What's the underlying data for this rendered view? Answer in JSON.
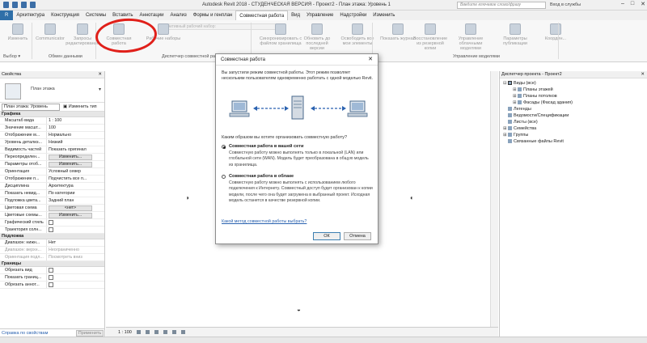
{
  "titlebar": {
    "title": "Autodesk Revit 2018 - СТУДЕНЧЕСКАЯ ВЕРСИЯ -   Проект2 - План этажа: Уровень 1",
    "search_placeholder": "Введите ключевое слово/фразу",
    "signin": "Вход в службы"
  },
  "tabs": [
    "Архитектура",
    "Конструкция",
    "Системы",
    "Вставить",
    "Аннотации",
    "Анализ",
    "Формы и генплан",
    "Совместная работа",
    "Вид",
    "Управление",
    "Надстройки",
    "Изменить"
  ],
  "active_tab": "Совместная работа",
  "ribbon": {
    "buttons": [
      {
        "label": "Изменить"
      },
      {
        "label": "Communicator"
      },
      {
        "label": "Запросы редактирования"
      },
      {
        "label": "Совместная работа"
      },
      {
        "label": "Рабочие наборы"
      },
      {
        "label": "Синхронизировать с файлом хранилища"
      },
      {
        "label": "Обновить до последней версии"
      },
      {
        "label": "Освободить все мои элементы"
      },
      {
        "label": "Показать журнал"
      },
      {
        "label": "Восстановление из резервной копии"
      },
      {
        "label": "Управление облачными моделями"
      },
      {
        "label": "Параметры публикации"
      },
      {
        "label": "Координ..."
      }
    ],
    "active_workset_placeholder": "Активный рабочий набор:",
    "panels": [
      "Выбор ▾",
      "Обмен данными",
      "Диспетчер совместной работы",
      "Управление моделями"
    ]
  },
  "properties": {
    "title": "Свойства",
    "type_name": "План этажа",
    "filter_value": "План этажа: Уровень",
    "edit_type": "Изменить тип",
    "groups": [
      {
        "name": "Графика",
        "rows": [
          {
            "k": "Масштаб вида",
            "v": "1 : 100"
          },
          {
            "k": "Значение масшт...",
            "v": "100"
          },
          {
            "k": "Отображение м...",
            "v": "Нормально"
          },
          {
            "k": "Уровень детализ...",
            "v": "Низкий"
          },
          {
            "k": "Видимость частей",
            "v": "Показать оригинал"
          },
          {
            "k": "Переопределен...",
            "v": "Изменить...",
            "btn": true
          },
          {
            "k": "Параметры отоб...",
            "v": "Изменить...",
            "btn": true
          },
          {
            "k": "Ориентация",
            "v": "Условный север"
          },
          {
            "k": "Отображение п...",
            "v": "Подчистить все п..."
          },
          {
            "k": "Дисциплина",
            "v": "Архитектура"
          },
          {
            "k": "Показать невид...",
            "v": "По категории"
          },
          {
            "k": "Подложка цвета...",
            "v": "Задний план"
          },
          {
            "k": "Цветовая схема",
            "v": "<нет>",
            "btn": true
          },
          {
            "k": "Цветовые схемы...",
            "v": "Изменить...",
            "btn": true
          },
          {
            "k": "Графический стиль",
            "v": "",
            "chk": true
          },
          {
            "k": "Траектория солн...",
            "v": "",
            "chk": true
          }
        ]
      },
      {
        "name": "Подложка",
        "rows": [
          {
            "k": "Диапазон: нижн...",
            "v": "Нет"
          },
          {
            "k": "Диапазон: верхн...",
            "v": "Неограниченно",
            "gray": true
          },
          {
            "k": "Ориентация подл...",
            "v": "Посмотреть вниз",
            "gray": true
          }
        ]
      },
      {
        "name": "Границы",
        "rows": [
          {
            "k": "Обрезать вид",
            "v": "",
            "chk": true
          },
          {
            "k": "Показать границ...",
            "v": "",
            "chk": true
          },
          {
            "k": "Обрезать аннот...",
            "v": "",
            "chk": true
          }
        ]
      }
    ],
    "help_link": "Справка по свойствам",
    "apply_label": "Применить"
  },
  "viewbar": {
    "scale": "1 : 100"
  },
  "browser": {
    "title": "Диспетчер проекта - Проект2",
    "nodes": [
      {
        "depth": 0,
        "toggle": "⊟",
        "label": "Виды (все)",
        "selected": true
      },
      {
        "depth": 1,
        "toggle": "⊞",
        "label": "Планы этажей"
      },
      {
        "depth": 1,
        "toggle": "⊞",
        "label": "Планы потолков"
      },
      {
        "depth": 1,
        "toggle": "⊞",
        "label": "Фасады (Фасад здания)"
      },
      {
        "depth": 0,
        "toggle": "",
        "label": "Легенды"
      },
      {
        "depth": 0,
        "toggle": "",
        "label": "Ведомости/Спецификации"
      },
      {
        "depth": 0,
        "toggle": "",
        "label": "Листы (все)"
      },
      {
        "depth": 0,
        "toggle": "⊞",
        "label": "Семейства"
      },
      {
        "depth": 0,
        "toggle": "⊞",
        "label": "Группы"
      },
      {
        "depth": 0,
        "toggle": "",
        "label": "Связанные файлы Revit"
      }
    ]
  },
  "dialog": {
    "title": "Совместная работа",
    "intro": "Вы запустили режим совместной работы. Этот режим позволяет нескольким пользователям одновременно работать с одной моделью Revit.",
    "question": "Каким образом вы хотите организовать совместную работу?",
    "option1_title": "Совместная работа в вашей сети",
    "option1_desc": "Совместную работу можно выполнять только в локальной (LAN) или глобальной сети (WAN). Модель будет преобразована в общую модель из хранилища.",
    "option2_title": "Совместная работа в облаке",
    "option2_desc": "Совместную работу можно выполнять с использованием любого подключения к Интернету. Совместный доступ будет организован к копии модели, после чего она будет загружена в выбранный проект. Исходная модель останется в качестве резервной копии.",
    "help_link": "Какой метод совместной работы выбрать?",
    "ok": "ОК",
    "cancel": "Отмена"
  }
}
